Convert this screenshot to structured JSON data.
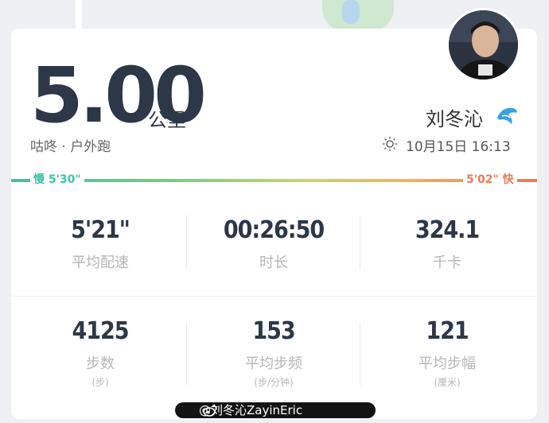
{
  "header": {
    "distance": "5.00",
    "distance_unit": "公里",
    "run_type": "咕咚 · 户外跑",
    "user_name": "刘冬沁",
    "datetime": "10月15日 16:13"
  },
  "pace": {
    "slow_label": "慢 5'30\"",
    "fast_label": "5'02\" 快",
    "colors": {
      "slow": "#38c6a5",
      "fast": "#ec7a55"
    }
  },
  "stats_row1": [
    {
      "value": "5'21\"",
      "label": "平均配速"
    },
    {
      "value": "00:26:50",
      "label": "时长"
    },
    {
      "value": "324.1",
      "label": "千卡"
    }
  ],
  "stats_row2": [
    {
      "value": "4125",
      "label": "步数",
      "unit": "(步)"
    },
    {
      "value": "153",
      "label": "平均步频",
      "unit": "(步/分钟)"
    },
    {
      "value": "121",
      "label": "平均步幅",
      "unit": "(厘米)"
    }
  ],
  "watermark": "@刘冬沁ZayinEric",
  "icons": {
    "weather": "sun-icon",
    "badge": "dolphin-icon",
    "watermark": "weibo-icon"
  }
}
